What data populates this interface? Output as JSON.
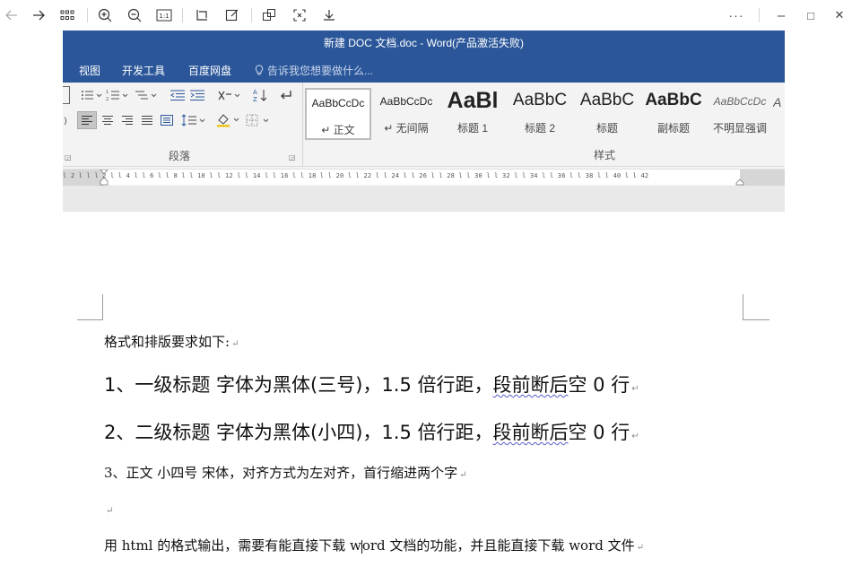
{
  "viewer_toolbar": {
    "icons": [
      "back-arrow-icon",
      "forward-arrow-icon",
      "grid-view-icon",
      "zoom-in-icon",
      "zoom-out-icon",
      "actual-size-icon",
      "rotate-icon",
      "edit-icon",
      "copy-icon",
      "fullscreen-icon",
      "download-icon"
    ],
    "more": "···",
    "minimize": "–",
    "maximize": "□",
    "close": "✕"
  },
  "word": {
    "title": "新建 DOC 文档.doc - Word(产品激活失败)",
    "menu": [
      "视图",
      "开发工具",
      "百度网盘"
    ],
    "tellme": "告诉我您想要做什么...",
    "paragraph_group_label": "段落",
    "styles_group_label": "样式",
    "styles": [
      {
        "sample": "AaBbCcDc",
        "name": "↵ 正文"
      },
      {
        "sample": "AaBbCcDc",
        "name": "↵ 无间隔"
      },
      {
        "sample": "AaBl",
        "name": "标题 1"
      },
      {
        "sample": "AaBbC",
        "name": "标题 2"
      },
      {
        "sample": "AaBbC",
        "name": "标题"
      },
      {
        "sample": "AaBbC",
        "name": "副标题"
      },
      {
        "sample": "AaBbCcDc",
        "name": "不明显强调"
      },
      {
        "sample": "A",
        "name": ""
      }
    ],
    "ruler": "l 2 l   l   l 2 l   l 4 l   l 6 l   l 8 l   l 10 l   l 12 l   l 14 l   l 16 l   l 18 l   l 20 l   l 22 l   l 24 l   l 26 l   l 28 l   l 30 l   l 32 l   l 34 l   l 36 l   l 38 l   l 40 l   l 42"
  },
  "document": {
    "line1": "格式和排版要求如下:",
    "line2_pre": "1、一级标题  字体为黑体(三号)，1.5 倍行距，",
    "line2_squig": "段前断后",
    "line2_post": "空 0 行",
    "line3_pre": "2、二级标题  字体为黑体(小四)，1.5 倍行距，",
    "line3_squig": "段前断后",
    "line3_post": "空 0 行",
    "line4": "3、正文  小四号  宋体，对齐方式为左对齐，首行缩进两个字",
    "line6_pre": "用 html 的格式输出，需要有能直接下载 w",
    "line6_post": "ord 文档的功能，并且能直接下载 word 文件",
    "para_mark": "↵"
  }
}
